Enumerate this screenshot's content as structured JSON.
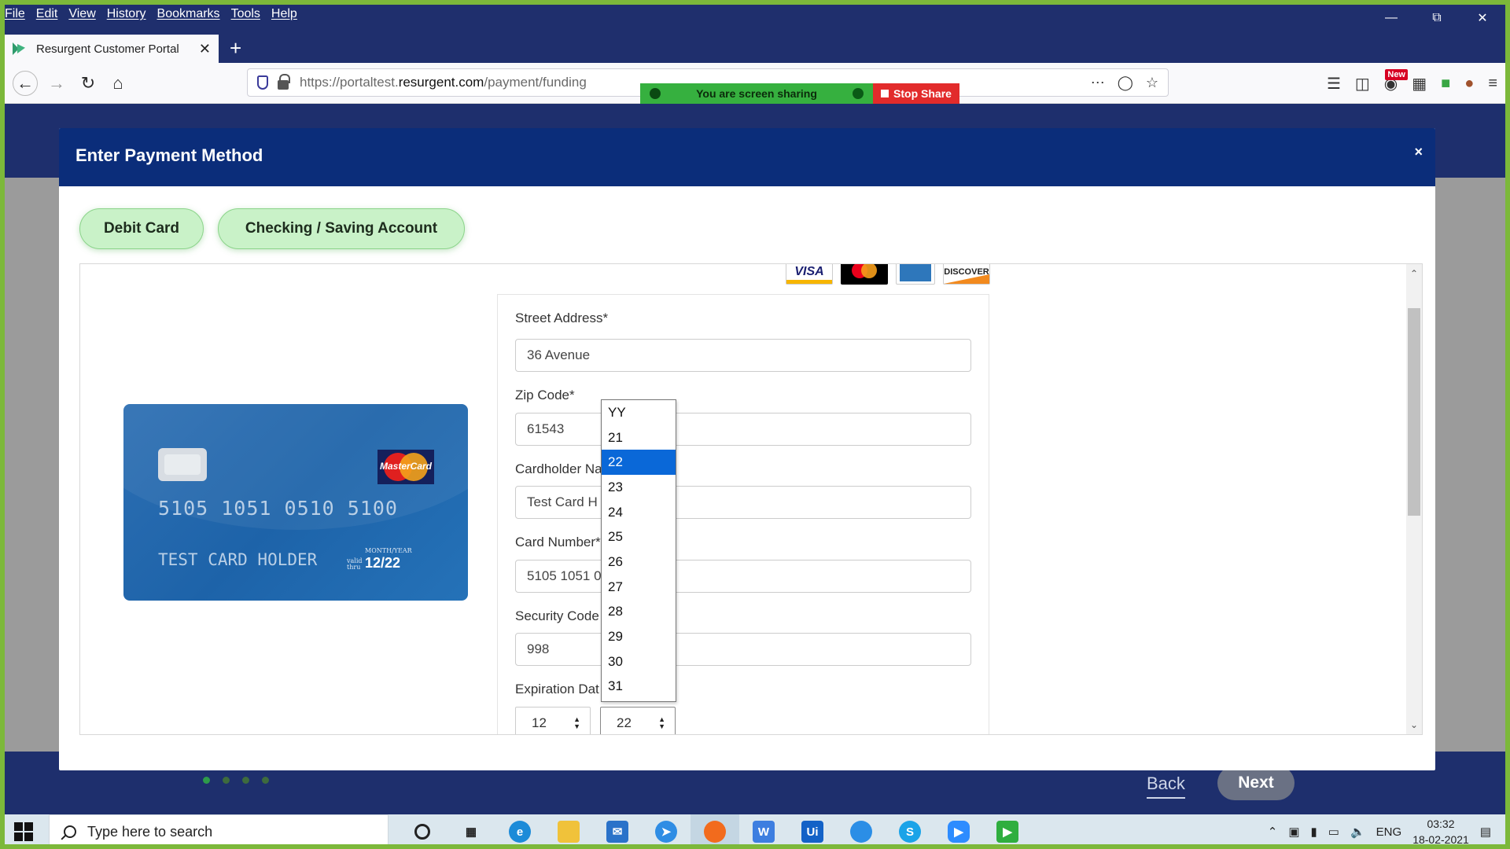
{
  "browser": {
    "menu": [
      "File",
      "Edit",
      "View",
      "History",
      "Bookmarks",
      "Tools",
      "Help"
    ],
    "tab_title": "Resurgent Customer Portal",
    "url_prefix": "https://portaltest.",
    "url_domain": "resurgent.com",
    "url_path": "/payment/funding",
    "share_text": "You are screen sharing",
    "stop_share": "Stop Share",
    "new_badge": "New"
  },
  "modal": {
    "title": "Enter Payment Method",
    "close": "×",
    "tabs": {
      "debit": "Debit Card",
      "checking": "Checking / Saving Account"
    },
    "card_logos": {
      "visa": "VISA",
      "discover": "DISCOVER"
    }
  },
  "card_preview": {
    "brand": "MasterCard",
    "number": "5105 1051 0510 5100",
    "holder": "TEST CARD HOLDER",
    "valid_thru_label": "valid thru",
    "month_year_label": "MONTH/YEAR",
    "expiry": "12/22"
  },
  "form": {
    "street_label": "Street Address*",
    "street_value": "36 Avenue",
    "zip_label": "Zip Code*",
    "zip_value": "61543",
    "holder_label": "Cardholder Na",
    "holder_value": "Test Card H",
    "number_label": "Card Number*",
    "number_value": "5105 1051 0",
    "security_label": "Security Code",
    "security_value": "998",
    "expiration_label": "Expiration Dat",
    "exp_month": "12",
    "exp_year": "22"
  },
  "year_dropdown": {
    "options": [
      "YY",
      "21",
      "22",
      "23",
      "24",
      "25",
      "26",
      "27",
      "28",
      "29",
      "30",
      "31"
    ],
    "selected": "22"
  },
  "footer": {
    "back": "Back",
    "next": "Next"
  },
  "taskbar": {
    "search_placeholder": "Type here to search",
    "lang": "ENG",
    "time": "03:32",
    "date": "18-02-2021"
  }
}
